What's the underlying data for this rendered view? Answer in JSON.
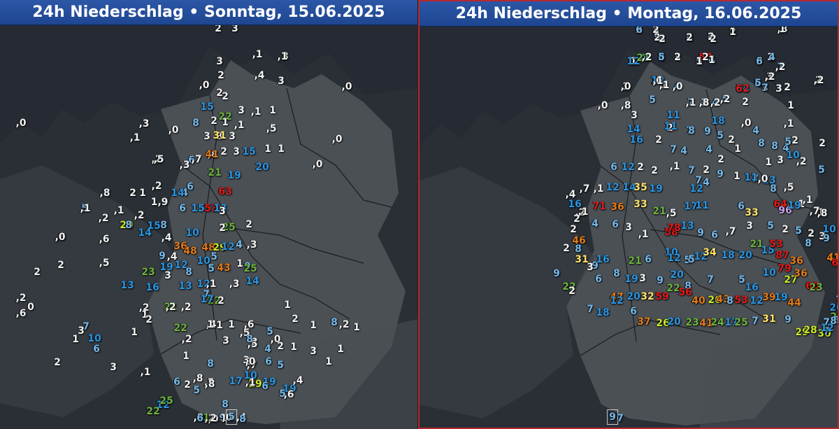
{
  "panels": {
    "left": {
      "title": "24h Niederschlag • Sonntag, 15.06.2025",
      "values": [
        "2",
        "3",
        "3",
        ",1",
        "3",
        ",1",
        "2",
        ",4",
        "3",
        "2",
        ",0",
        ",0",
        "2",
        "2",
        ",0",
        "3",
        "1",
        ",1",
        "15",
        "22",
        "1",
        "8",
        "3",
        "3",
        ",1",
        ",5",
        "31",
        ",8",
        "3",
        "41",
        "2",
        "3",
        "15",
        "1",
        "1",
        "20",
        "6",
        "21",
        "19",
        ",0",
        ",0",
        ",2",
        ",3",
        ",7",
        ",2",
        "63",
        "6",
        "4",
        ",8",
        "1",
        "2",
        "1,9",
        "14",
        "6",
        "15",
        "53",
        "13",
        "3",
        "5",
        ",2",
        ",1",
        ",2",
        "29",
        "8",
        "15",
        "8",
        "14",
        "10",
        "25",
        ",8",
        ",6",
        "2",
        "2",
        ",4",
        "36",
        "48",
        "29",
        "4",
        ",3",
        "9",
        ",4",
        "48",
        "5",
        "12",
        "9",
        "12",
        "19",
        "8",
        "10",
        "5",
        "43",
        "23",
        "3",
        "1",
        "25",
        "16",
        "13",
        "12",
        ",1",
        ",3",
        "14",
        "7",
        "22",
        "21",
        "13",
        ",2",
        ",2",
        ",2",
        "0",
        ",6",
        "2",
        "2",
        ",5",
        ",2",
        "1",
        "2",
        "17",
        "2",
        ",4",
        "1",
        "1",
        "1",
        ",6",
        "1",
        "3",
        ",5",
        "5",
        "2",
        ",2",
        "1",
        "4",
        ",5",
        ",0",
        "8",
        "2",
        "1",
        "8",
        ",2",
        "1",
        "3",
        ",7",
        "2",
        "1",
        "3",
        "1",
        "1",
        "19",
        "19",
        "5",
        ",6",
        ",4",
        "6",
        "6",
        "1",
        "10",
        "5",
        "6",
        "2",
        "5",
        "8",
        ",8",
        "12",
        "25",
        "22",
        "17",
        "9",
        "8",
        "21",
        "29",
        "22",
        "7",
        "3",
        "6",
        "1",
        "10",
        "2",
        "3",
        "1",
        ",1",
        "1",
        ",0",
        ",0",
        ",3",
        ",4",
        ",2",
        ",1",
        ",5",
        ",8",
        ",0",
        ",0",
        ",5",
        ",1",
        ",3",
        ",0",
        ",1"
      ],
      "bottom_row": [
        "6",
        "2",
        "5",
        "8"
      ]
    },
    "right": {
      "title": "24h Niederschlag • Montag, 16.06.2025",
      "values": [
        "2",
        "3",
        "5",
        "4",
        "4",
        "2",
        ",8",
        "3",
        "4",
        "1",
        "8",
        "3",
        "5",
        "53",
        "4",
        "3",
        "2",
        "1",
        "1",
        "4",
        "13",
        "4",
        "3",
        "7",
        "1",
        "2",
        "1",
        "13",
        "4",
        "7",
        "3",
        "4",
        "5",
        "14",
        "6",
        "3",
        "3",
        "2",
        ",0",
        ",8",
        "3",
        "5",
        "11",
        "7",
        "18",
        "2",
        "1",
        ",0",
        ",1",
        "2",
        "2",
        "11",
        "8",
        "9",
        "5",
        "2",
        "4",
        "8",
        "14",
        "16",
        "2",
        "7",
        "4",
        "4",
        "2",
        "1",
        "8",
        "4",
        ",2",
        "2",
        "5",
        "5",
        "1",
        "3",
        "10",
        "6",
        "12",
        "2",
        "2",
        ",1",
        "7",
        "2",
        "9",
        "1",
        "7",
        "13",
        "8",
        ",5",
        "1",
        ",1",
        "1",
        ",7",
        ",1",
        "12",
        "14",
        "35",
        "19",
        "12",
        "7",
        "4",
        "11",
        ",0",
        ",4",
        ",2",
        ",1",
        "16",
        "71",
        "36",
        "33",
        "21",
        ",5",
        "17",
        "11",
        "6",
        "33",
        "64",
        "96",
        "19",
        ",7",
        ",8",
        "2",
        "4",
        "2",
        "6",
        "3",
        ",1",
        "58",
        "78",
        "13",
        "9",
        "6",
        ",7",
        "3",
        "5",
        "2",
        "5",
        "2",
        "3",
        "2",
        "8",
        "46",
        "31",
        "9",
        "16",
        "21",
        "6",
        "10",
        "12",
        "5",
        "5",
        "12",
        "34",
        "18",
        "20",
        "21",
        "15",
        "53",
        "87",
        "36",
        "10",
        "8",
        "9",
        "9",
        "22",
        "2",
        "3",
        "6",
        "8",
        "19",
        "3",
        "9",
        "20",
        "8",
        "7",
        "5",
        "16",
        "10",
        "79",
        "27",
        "36",
        "60",
        "23",
        "47",
        "41",
        "69",
        "47",
        "20",
        "32",
        "59",
        "22",
        "56",
        "40",
        "26",
        "43",
        "8",
        "53",
        "12",
        "39",
        "19",
        "44",
        "7",
        "18",
        "12",
        "6",
        "37",
        "26",
        "20",
        "23",
        "41",
        "24",
        "17",
        "25",
        "7",
        "31",
        "9",
        "29",
        "28",
        "30",
        "7",
        "20",
        "23",
        "8",
        "8",
        "7",
        "12",
        "7",
        "6",
        "2",
        "2",
        "2",
        "2",
        "1",
        "1",
        "2",
        "2",
        "2",
        "5",
        "2",
        "1",
        "2",
        "1",
        "6",
        "3",
        "4",
        "12",
        "21",
        ",6",
        ",2",
        ",2",
        ",2",
        ",0",
        ",2",
        ",1",
        ",1",
        ",0",
        ",1",
        ",8",
        ",2",
        ",2",
        "62",
        "5",
        "7"
      ],
      "bottom_row": [
        "9",
        "7"
      ]
    }
  },
  "colors": {
    "white": "#f2f2f2",
    "light_blue": "#74b9ea",
    "blue": "#2b95e0",
    "green": "#6db33f",
    "yellow_green": "#c9e82a",
    "yellow": "#ffe36b",
    "orange": "#e07a1a",
    "red": "#e01a1a",
    "purple": "#c9a0e8"
  }
}
